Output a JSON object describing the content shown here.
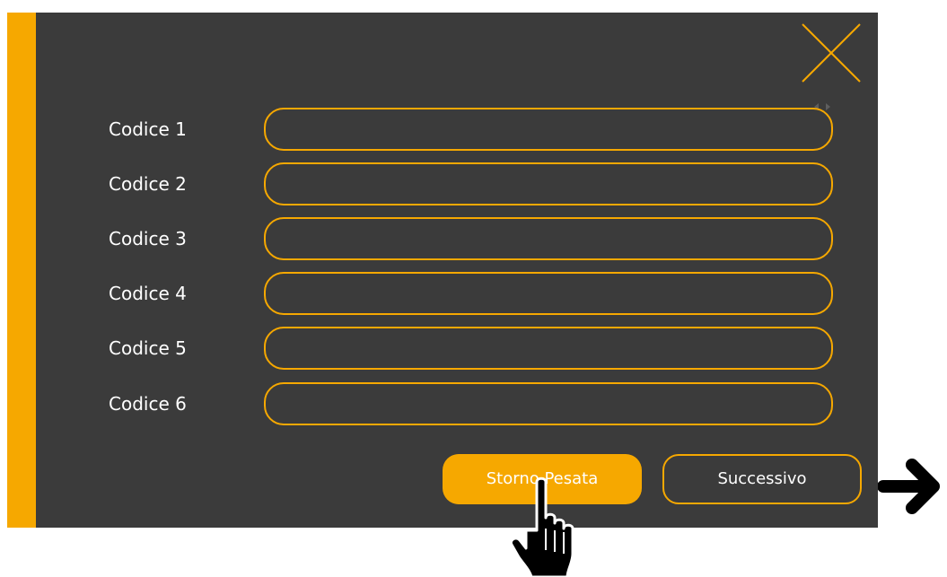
{
  "dialog": {
    "fields": [
      {
        "label": "Codice 1",
        "value": ""
      },
      {
        "label": "Codice 2",
        "value": ""
      },
      {
        "label": "Codice 3",
        "value": ""
      },
      {
        "label": "Codice 4",
        "value": ""
      },
      {
        "label": "Codice 5",
        "value": ""
      },
      {
        "label": "Codice 6",
        "value": ""
      }
    ],
    "buttons": {
      "storno": "Storno Pesata",
      "successivo": "Successivo"
    },
    "close_icon": "close-x-icon",
    "scroll_icon": "left-right-arrows-icon"
  },
  "overlay": {
    "pointer_icon": "hand-pointer-icon",
    "next_arrow_icon": "right-arrow-icon"
  },
  "colors": {
    "panel_bg": "#3b3b3b",
    "accent": "#f6a800",
    "text": "#ffffff"
  }
}
